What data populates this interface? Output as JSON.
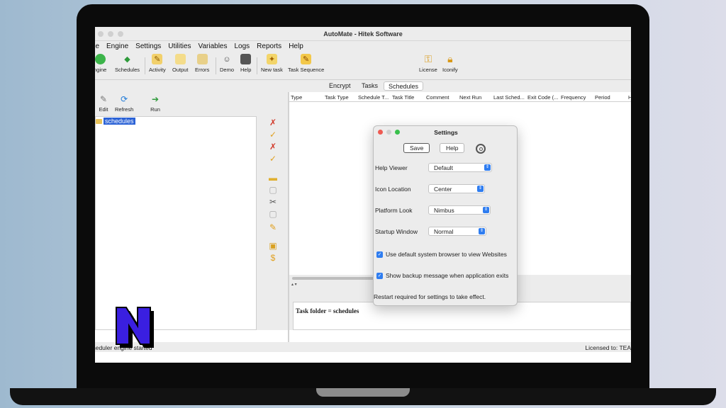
{
  "window": {
    "title": "AutoMate - Hitek Software"
  },
  "menu": [
    "ile",
    "Engine",
    "Settings",
    "Utilities",
    "Variables",
    "Logs",
    "Reports",
    "Help"
  ],
  "toolbar": {
    "engine": "ngine",
    "schedules": "Schedules",
    "activity": "Activity",
    "output": "Output",
    "errors": "Errors",
    "demo": "Demo",
    "help": "Help",
    "new_task": "New task",
    "task_sequence": "Task Sequence",
    "license": "License",
    "iconify": "Iconify"
  },
  "tabs": [
    "Encrypt",
    "Tasks",
    "Schedules"
  ],
  "left_tools": {
    "edit": "Edit",
    "refresh": "Refresh",
    "run": "Run"
  },
  "tree": {
    "root": "schedules"
  },
  "table_columns": [
    "Type",
    "Task Type",
    "Schedule T...",
    "Task Title",
    "Comment",
    "Next Run",
    "Last Sched...",
    "Exit Code (...",
    "Frequency",
    "Period",
    "H"
  ],
  "detail": {
    "text": "Task folder = schedules"
  },
  "status": {
    "left": "heduler engine started",
    "right": "Licensed to: TEA"
  },
  "settings": {
    "title": "Settings",
    "save_label": "Save",
    "help_label": "Help",
    "help_viewer_label": "Help Viewer",
    "help_viewer_value": "Default",
    "icon_location_label": "Icon Location",
    "icon_location_value": "Center",
    "platform_look_label": "Platform Look",
    "platform_look_value": "Nimbus",
    "startup_window_label": "Startup Window",
    "startup_window_value": "Normal",
    "check1": "Use default system browser to view Websites",
    "check2": "Show backup message when application exits",
    "note": "Restart required for settings to take effect."
  },
  "logo": {
    "letter": "N"
  },
  "colors": {
    "accent": "#2f7df0",
    "selection": "#2b62d6",
    "logo_blue": "#3a1fe0"
  }
}
